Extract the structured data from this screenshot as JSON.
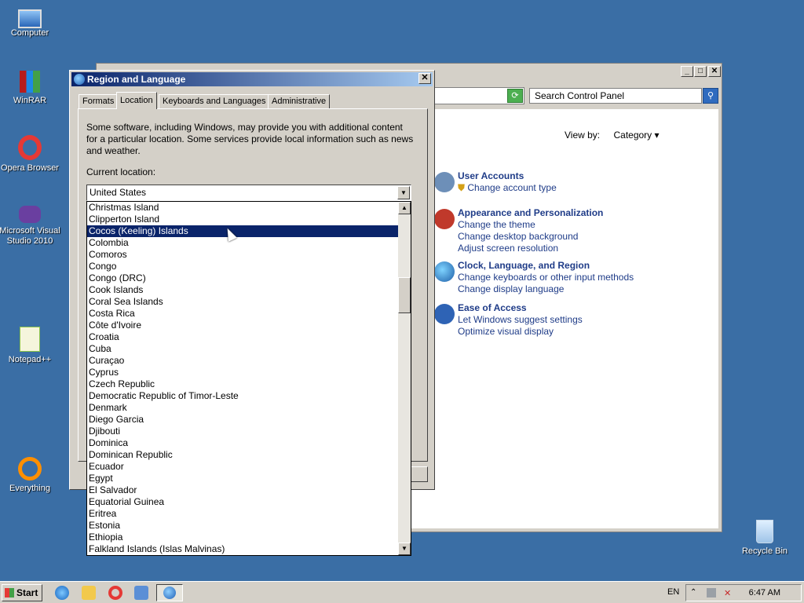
{
  "desktop": {
    "icons": [
      {
        "label": "Computer"
      },
      {
        "label": "WinRAR"
      },
      {
        "label": "Opera Browser"
      },
      {
        "label": "Microsoft Visual Studio 2010"
      },
      {
        "label": "Notepad++"
      },
      {
        "label": "Everything"
      },
      {
        "label": "Recycle Bin"
      }
    ]
  },
  "control_panel": {
    "search_placeholder": "Search Control Panel",
    "view_by_label": "View by:",
    "view_by_value": "Category",
    "categories": [
      {
        "title": "User Accounts",
        "links": [
          "Change account type"
        ]
      },
      {
        "title": "Appearance and Personalization",
        "links": [
          "Change the theme",
          "Change desktop background",
          "Adjust screen resolution"
        ]
      },
      {
        "title": "Clock, Language, and Region",
        "links": [
          "Change keyboards or other input methods",
          "Change display language"
        ]
      },
      {
        "title": "Ease of Access",
        "links": [
          "Let Windows suggest settings",
          "Optimize visual display"
        ]
      }
    ]
  },
  "dialog": {
    "title": "Region and Language",
    "tabs": [
      "Formats",
      "Location",
      "Keyboards and Languages",
      "Administrative"
    ],
    "active_tab": "Location",
    "description": "Some software, including Windows, may provide you with additional content for a particular location. Some services provide local information such as news and weather.",
    "current_location_label": "Current location:",
    "current_location_value": "United States"
  },
  "location_list": {
    "selected": "Cocos (Keeling) Islands",
    "items": [
      "Christmas Island",
      "Clipperton Island",
      "Cocos (Keeling) Islands",
      "Colombia",
      "Comoros",
      "Congo",
      "Congo (DRC)",
      "Cook Islands",
      "Coral Sea Islands",
      "Costa Rica",
      "Côte d'Ivoire",
      "Croatia",
      "Cuba",
      "Curaçao",
      "Cyprus",
      "Czech Republic",
      "Democratic Republic of Timor-Leste",
      "Denmark",
      "Diego Garcia",
      "Djibouti",
      "Dominica",
      "Dominican Republic",
      "Ecuador",
      "Egypt",
      "El Salvador",
      "Equatorial Guinea",
      "Eritrea",
      "Estonia",
      "Ethiopia",
      "Falkland Islands (Islas Malvinas)"
    ]
  },
  "taskbar": {
    "start_label": "Start",
    "language": "EN",
    "clock": "6:47 AM"
  },
  "colors": {
    "desktop": "#3a6ea5",
    "selection": "#0a246a",
    "link": "#1f3c88"
  }
}
